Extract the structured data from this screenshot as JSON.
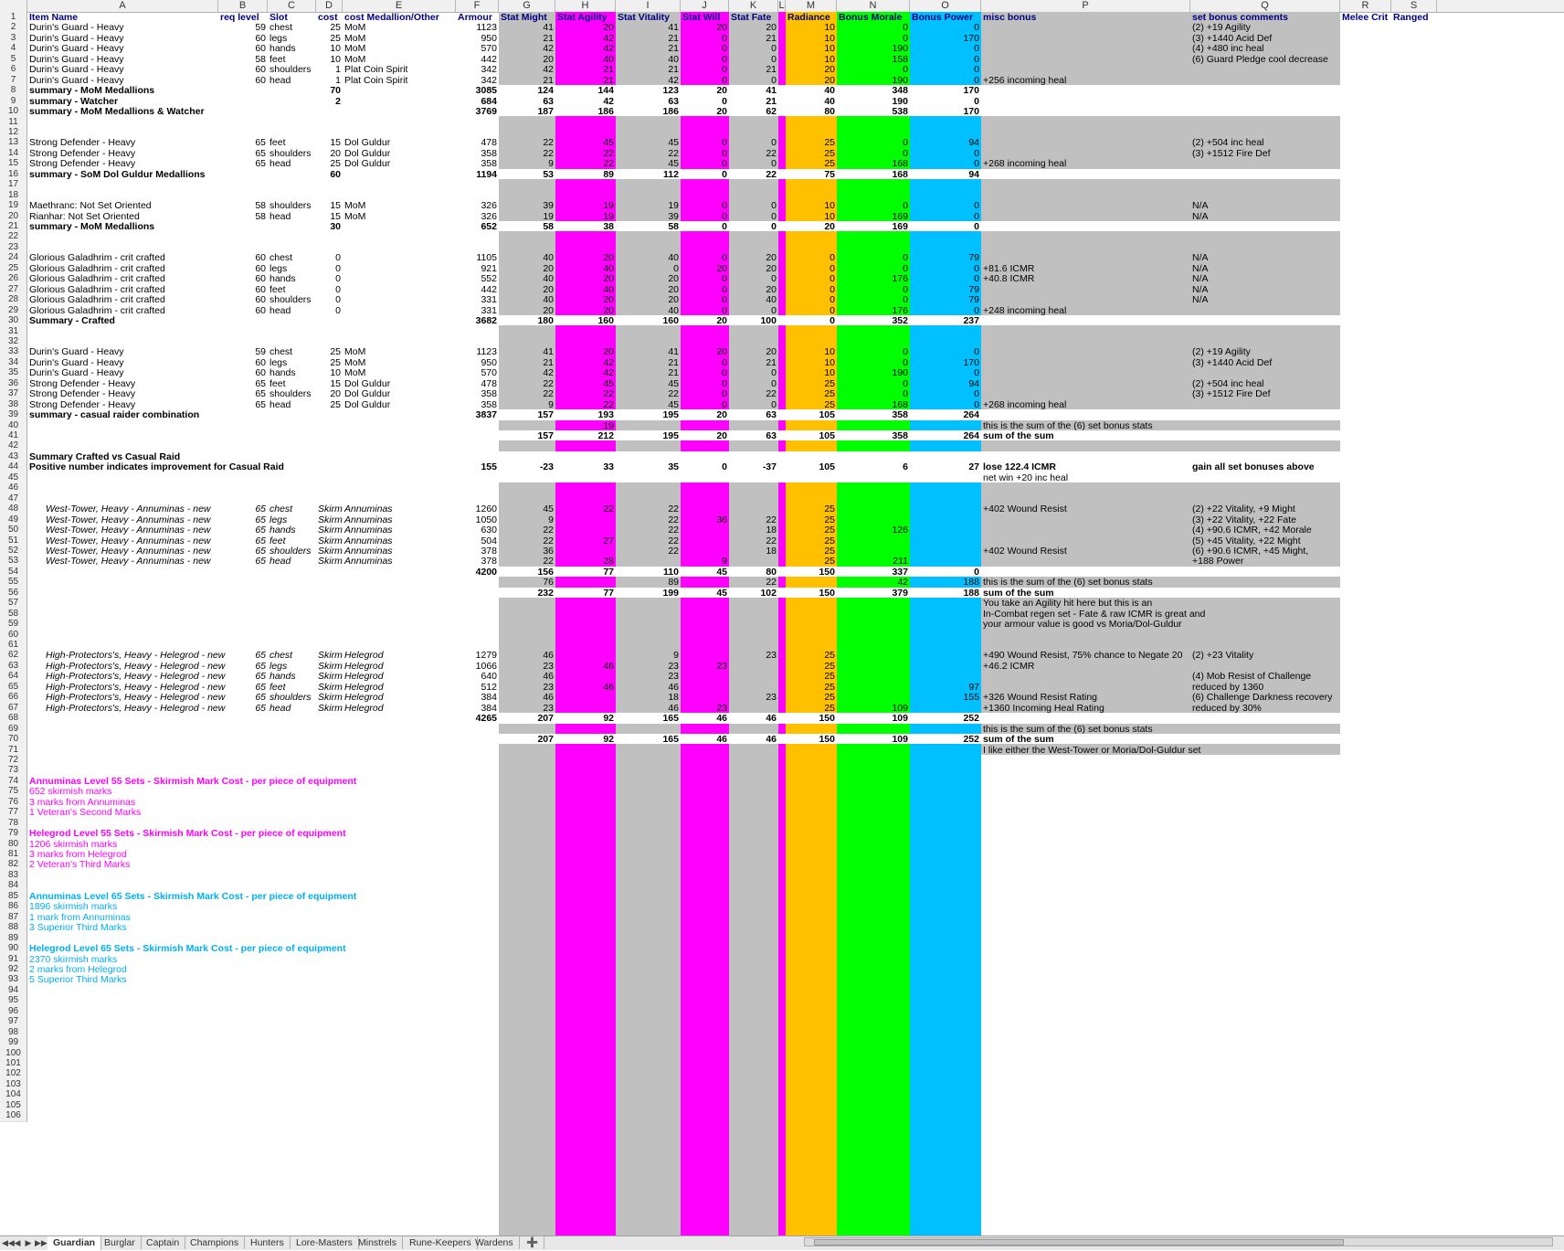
{
  "colors": {
    "gray": "#c0c0c0",
    "magenta": "#ff00ff",
    "orange": "#ffc000",
    "green": "#00ff00",
    "cyan": "#00c0ff",
    "header_text": "#000080",
    "pink_text": "#ff00ff",
    "blue_text": "#00b0f0"
  },
  "columns": [
    "A",
    "B",
    "C",
    "D",
    "E",
    "F",
    "G",
    "H",
    "I",
    "J",
    "K",
    "L",
    "M",
    "N",
    "O",
    "P",
    "Q",
    "R",
    "S"
  ],
  "header": {
    "A": "Item Name",
    "B": "req level",
    "C": "Slot",
    "D": "cost",
    "E": "cost Medallion/Other",
    "F": "Armour",
    "G": "Stat Might",
    "H": "Stat Agility",
    "I": "Stat Vitality",
    "J": "Stat Will",
    "K": "Stat Fate",
    "L": "",
    "M": "Radiance",
    "N": "Bonus Morale",
    "O": "Bonus Power",
    "P": "misc bonus",
    "Q": "set bonus comments",
    "R": "Melee Crit",
    "S": "Ranged"
  },
  "rows": [
    {
      "n": 2,
      "A": "Durin's Guard - Heavy",
      "B": "59",
      "C": "chest",
      "D": "25",
      "E": "MoM",
      "F": "1123",
      "G": "41",
      "H": "20",
      "I": "41",
      "J": "20",
      "K": "20",
      "M": "10",
      "N": "0",
      "O": "0",
      "Q": "(2) +19 Agility"
    },
    {
      "n": 3,
      "A": "Durin's Guard - Heavy",
      "B": "60",
      "C": "legs",
      "D": "25",
      "E": "MoM",
      "F": "950",
      "G": "21",
      "H": "42",
      "I": "21",
      "J": "0",
      "K": "21",
      "M": "10",
      "N": "0",
      "O": "170",
      "Q": "(3) +1440 Acid Def"
    },
    {
      "n": 4,
      "A": "Durin's Guard - Heavy",
      "B": "60",
      "C": "hands",
      "D": "10",
      "E": "MoM",
      "F": "570",
      "G": "42",
      "H": "42",
      "I": "21",
      "J": "0",
      "K": "0",
      "M": "10",
      "N": "190",
      "O": "0",
      "Q": "(4) +480 inc heal"
    },
    {
      "n": 5,
      "A": "Durin's Guard - Heavy",
      "B": "58",
      "C": "feet",
      "D": "10",
      "E": "MoM",
      "F": "442",
      "G": "20",
      "H": "40",
      "I": "40",
      "J": "0",
      "K": "0",
      "M": "10",
      "N": "158",
      "O": "0",
      "Q": "(6) Guard Pledge cool decrease"
    },
    {
      "n": 6,
      "A": "Durin's Guard - Heavy",
      "B": "60",
      "C": "shoulders",
      "D": "1",
      "E": "Plat Coin Spirit",
      "F": "342",
      "G": "42",
      "H": "21",
      "I": "21",
      "J": "0",
      "K": "21",
      "M": "20",
      "N": "0",
      "O": "0"
    },
    {
      "n": 7,
      "A": "Durin's Guard - Heavy",
      "B": "60",
      "C": "head",
      "D": "1",
      "E": "Plat Coin Spirit",
      "F": "342",
      "G": "21",
      "H": "21",
      "I": "42",
      "J": "0",
      "K": "0",
      "M": "20",
      "N": "190",
      "O": "0",
      "P": "+256 incoming heal"
    },
    {
      "n": 8,
      "A": "summary - MoM Medallions",
      "D": "70",
      "F": "3085",
      "G": "124",
      "H": "144",
      "I": "123",
      "J": "20",
      "K": "41",
      "M": "40",
      "N": "348",
      "O": "170",
      "bold": true,
      "white": true
    },
    {
      "n": 9,
      "A": "summary - Watcher",
      "D": "2",
      "F": "684",
      "G": "63",
      "H": "42",
      "I": "63",
      "J": "0",
      "K": "21",
      "M": "40",
      "N": "190",
      "O": "0",
      "bold": true,
      "white": true
    },
    {
      "n": 10,
      "A": "summary - MoM Medallions & Watcher",
      "F": "3769",
      "G": "187",
      "H": "186",
      "I": "186",
      "J": "20",
      "K": "62",
      "M": "80",
      "N": "538",
      "O": "170",
      "bold": true,
      "white": true
    },
    {
      "n": 11
    },
    {
      "n": 12
    },
    {
      "n": 13,
      "A": "Strong Defender - Heavy",
      "B": "65",
      "C": "feet",
      "D": "15",
      "E": "Dol Guldur",
      "F": "478",
      "G": "22",
      "H": "45",
      "I": "45",
      "J": "0",
      "K": "0",
      "M": "25",
      "N": "0",
      "O": "94",
      "Q": "(2) +504 inc heal"
    },
    {
      "n": 14,
      "A": "Strong Defender - Heavy",
      "B": "65",
      "C": "shoulders",
      "D": "20",
      "E": "Dol Guldur",
      "F": "358",
      "G": "22",
      "H": "22",
      "I": "22",
      "J": "0",
      "K": "22",
      "M": "25",
      "N": "0",
      "O": "0",
      "Q": "(3) +1512 Fire Def"
    },
    {
      "n": 15,
      "A": "Strong Defender - Heavy",
      "B": "65",
      "C": "head",
      "D": "25",
      "E": "Dol Guldur",
      "F": "358",
      "G": "9",
      "H": "22",
      "I": "45",
      "J": "0",
      "K": "0",
      "M": "25",
      "N": "168",
      "O": "0",
      "P": "+268 incoming heal"
    },
    {
      "n": 16,
      "A": "summary - SoM Dol Guldur Medallions",
      "D": "60",
      "F": "1194",
      "G": "53",
      "H": "89",
      "I": "112",
      "J": "0",
      "K": "22",
      "M": "75",
      "N": "168",
      "O": "94",
      "bold": true,
      "white": true
    },
    {
      "n": 17
    },
    {
      "n": 18
    },
    {
      "n": 19,
      "A": "Maethranc: Not Set Oriented",
      "B": "58",
      "C": "shoulders",
      "D": "15",
      "E": "MoM",
      "F": "326",
      "G": "39",
      "H": "19",
      "I": "19",
      "J": "0",
      "K": "0",
      "M": "10",
      "N": "0",
      "O": "0",
      "Q": "N/A"
    },
    {
      "n": 20,
      "A": "Rianhar: Not Set Oriented",
      "B": "58",
      "C": "head",
      "D": "15",
      "E": "MoM",
      "F": "326",
      "G": "19",
      "H": "19",
      "I": "39",
      "J": "0",
      "K": "0",
      "M": "10",
      "N": "169",
      "O": "0",
      "Q": "N/A"
    },
    {
      "n": 21,
      "A": "summary - MoM Medallions",
      "D": "30",
      "F": "652",
      "G": "58",
      "H": "38",
      "I": "58",
      "J": "0",
      "K": "0",
      "M": "20",
      "N": "169",
      "O": "0",
      "bold": true,
      "white": true
    },
    {
      "n": 22
    },
    {
      "n": 23
    },
    {
      "n": 24,
      "A": "Glorious Galadhrim - crit crafted",
      "B": "60",
      "C": "chest",
      "D": "0",
      "F": "1105",
      "G": "40",
      "H": "20",
      "I": "40",
      "J": "0",
      "K": "20",
      "M": "0",
      "N": "0",
      "O": "79",
      "Q": "N/A"
    },
    {
      "n": 25,
      "A": "Glorious Galadhrim - crit crafted",
      "B": "60",
      "C": "legs",
      "D": "0",
      "F": "921",
      "G": "20",
      "H": "40",
      "I": "0",
      "J": "20",
      "K": "20",
      "M": "0",
      "N": "0",
      "O": "0",
      "P": "+81.6 ICMR",
      "Q": "N/A"
    },
    {
      "n": 26,
      "A": "Glorious Galadhrim - crit crafted",
      "B": "60",
      "C": "hands",
      "D": "0",
      "F": "552",
      "G": "40",
      "H": "20",
      "I": "20",
      "J": "0",
      "K": "0",
      "M": "0",
      "N": "176",
      "O": "0",
      "P": "+40.8 ICMR",
      "Q": "N/A"
    },
    {
      "n": 27,
      "A": "Glorious Galadhrim - crit crafted",
      "B": "60",
      "C": "feet",
      "D": "0",
      "F": "442",
      "G": "20",
      "H": "40",
      "I": "20",
      "J": "0",
      "K": "20",
      "M": "0",
      "N": "0",
      "O": "79",
      "Q": "N/A"
    },
    {
      "n": 28,
      "A": "Glorious Galadhrim - crit crafted",
      "B": "60",
      "C": "shoulders",
      "D": "0",
      "F": "331",
      "G": "40",
      "H": "20",
      "I": "20",
      "J": "0",
      "K": "40",
      "M": "0",
      "N": "0",
      "O": "79",
      "Q": "N/A"
    },
    {
      "n": 29,
      "A": "Glorious Galadhrim - crit crafted",
      "B": "60",
      "C": "head",
      "D": "0",
      "F": "331",
      "G": "20",
      "H": "20",
      "I": "40",
      "J": "0",
      "K": "0",
      "M": "0",
      "N": "176",
      "O": "0",
      "P": "+248 incoming heal"
    },
    {
      "n": 30,
      "A": "Summary - Crafted",
      "F": "3682",
      "G": "180",
      "H": "160",
      "I": "160",
      "J": "20",
      "K": "100",
      "M": "0",
      "N": "352",
      "O": "237",
      "bold": true,
      "white": true
    },
    {
      "n": 31
    },
    {
      "n": 32
    },
    {
      "n": 33,
      "A": "Durin's Guard - Heavy",
      "B": "59",
      "C": "chest",
      "D": "25",
      "E": "MoM",
      "F": "1123",
      "G": "41",
      "H": "20",
      "I": "41",
      "J": "20",
      "K": "20",
      "M": "10",
      "N": "0",
      "O": "0",
      "Q": "(2) +19 Agility"
    },
    {
      "n": 34,
      "A": "Durin's Guard - Heavy",
      "B": "60",
      "C": "legs",
      "D": "25",
      "E": "MoM",
      "F": "950",
      "G": "21",
      "H": "42",
      "I": "21",
      "J": "0",
      "K": "21",
      "M": "10",
      "N": "0",
      "O": "170",
      "Q": "(3) +1440 Acid Def"
    },
    {
      "n": 35,
      "A": "Durin's Guard - Heavy",
      "B": "60",
      "C": "hands",
      "D": "10",
      "E": "MoM",
      "F": "570",
      "G": "42",
      "H": "42",
      "I": "21",
      "J": "0",
      "K": "0",
      "M": "10",
      "N": "190",
      "O": "0"
    },
    {
      "n": 36,
      "A": "Strong Defender - Heavy",
      "B": "65",
      "C": "feet",
      "D": "15",
      "E": "Dol Guldur",
      "F": "478",
      "G": "22",
      "H": "45",
      "I": "45",
      "J": "0",
      "K": "0",
      "M": "25",
      "N": "0",
      "O": "94",
      "Q": "(2) +504 inc heal"
    },
    {
      "n": 37,
      "A": "Strong Defender - Heavy",
      "B": "65",
      "C": "shoulders",
      "D": "20",
      "E": "Dol Guldur",
      "F": "358",
      "G": "22",
      "H": "22",
      "I": "22",
      "J": "0",
      "K": "22",
      "M": "25",
      "N": "0",
      "O": "0",
      "Q": "(3) +1512 Fire Def"
    },
    {
      "n": 38,
      "A": "Strong Defender - Heavy",
      "B": "65",
      "C": "head",
      "D": "25",
      "E": "Dol Guldur",
      "F": "358",
      "G": "9",
      "H": "22",
      "I": "45",
      "J": "0",
      "K": "0",
      "M": "25",
      "N": "168",
      "O": "0",
      "P": "+268 incoming heal"
    },
    {
      "n": 39,
      "A": "summary - casual raider combination",
      "F": "3837",
      "G": "157",
      "H": "193",
      "I": "195",
      "J": "20",
      "K": "63",
      "M": "105",
      "N": "358",
      "O": "264",
      "bold": true,
      "white": true
    },
    {
      "n": 40,
      "H": "19",
      "P": "this is the sum of the (6) set bonus stats"
    },
    {
      "n": 41,
      "G": "157",
      "H": "212",
      "I": "195",
      "J": "20",
      "K": "63",
      "M": "105",
      "N": "358",
      "O": "264",
      "P": "sum of the sum",
      "bold": true,
      "white": true
    },
    {
      "n": 42
    },
    {
      "n": 43,
      "A": "Summary Crafted vs Casual Raid",
      "bold": true,
      "white": true
    },
    {
      "n": 44,
      "A": "Positive number indicates improvement for Casual Raid",
      "F": "155",
      "G": "-23",
      "H": "33",
      "I": "35",
      "J": "0",
      "K": "-37",
      "M": "105",
      "N": "6",
      "O": "27",
      "P": "lose 122.4 ICMR",
      "Q": "gain all set bonuses above",
      "bold": true,
      "white": true
    },
    {
      "n": 45,
      "P": "net win +20 inc heal",
      "white": true
    },
    {
      "n": 46
    },
    {
      "n": 47
    },
    {
      "n": 48,
      "A": "West-Tower, Heavy - Annuminas - new",
      "B": "65",
      "C": "chest",
      "D": "Skirm",
      "E": "Annuminas",
      "F": "1260",
      "G": "45",
      "H": "22",
      "I": "22",
      "M": "25",
      "P": "+402 Wound Resist",
      "Q": "(2) +22 Vitality, +9 Might",
      "italic": true
    },
    {
      "n": 49,
      "A": "West-Tower, Heavy - Annuminas - new",
      "B": "65",
      "C": "legs",
      "D": "Skirm",
      "E": "Annuminas",
      "F": "1050",
      "G": "9",
      "I": "22",
      "J": "36",
      "K": "22",
      "M": "25",
      "Q": "(3) +22 Vitality, +22 Fate",
      "italic": true
    },
    {
      "n": 50,
      "A": "West-Tower, Heavy - Annuminas - new",
      "B": "65",
      "C": "hands",
      "D": "Skirm",
      "E": "Annuminas",
      "F": "630",
      "G": "22",
      "I": "22",
      "K": "18",
      "M": "25",
      "N": "126",
      "Q": "(4) +90.6 ICMR, +42 Morale",
      "italic": true
    },
    {
      "n": 51,
      "A": "West-Tower, Heavy - Annuminas - new",
      "B": "65",
      "C": "feet",
      "D": "Skirm",
      "E": "Annuminas",
      "F": "504",
      "G": "22",
      "H": "27",
      "I": "22",
      "K": "22",
      "M": "25",
      "Q": "(5) +45 Vitality, +22 Might",
      "italic": true
    },
    {
      "n": 52,
      "A": "West-Tower, Heavy - Annuminas - new",
      "B": "65",
      "C": "shoulders",
      "D": "Skirm",
      "E": "Annuminas",
      "F": "378",
      "G": "36",
      "I": "22",
      "K": "18",
      "M": "25",
      "P": "+402 Wound Resist",
      "Q": "(6) +90.6 ICMR, +45 Might,",
      "italic": true
    },
    {
      "n": 53,
      "A": "West-Tower, Heavy - Annuminas - new",
      "B": "65",
      "C": "head",
      "D": "Skirm",
      "E": "Annuminas",
      "F": "378",
      "G": "22",
      "H": "28",
      "J": "9",
      "M": "25",
      "N": "211",
      "Q": "+188 Power",
      "italic": true
    },
    {
      "n": 54,
      "F": "4200",
      "G": "156",
      "H": "77",
      "I": "110",
      "J": "45",
      "K": "80",
      "M": "150",
      "N": "337",
      "O": "0",
      "bold": true,
      "white": true
    },
    {
      "n": 55,
      "G": "76",
      "I": "89",
      "K": "22",
      "N": "42",
      "O": "188",
      "P": "this is the sum of the (6) set bonus stats"
    },
    {
      "n": 56,
      "G": "232",
      "H": "77",
      "I": "199",
      "J": "45",
      "K": "102",
      "M": "150",
      "N": "379",
      "O": "188",
      "P": "sum of the sum",
      "bold": true,
      "white": true
    },
    {
      "n": 57,
      "P": "You take an Agility hit here but this is an"
    },
    {
      "n": 58,
      "P": "In-Combat regen set - Fate & raw ICMR is great and"
    },
    {
      "n": 59,
      "P": "your armour value is good vs Moria/Dol-Guldur"
    },
    {
      "n": 60
    },
    {
      "n": 61
    },
    {
      "n": 62,
      "A": "High-Protectors's, Heavy - Helegrod - new",
      "B": "65",
      "C": "chest",
      "D": "Skirm",
      "E": "Helegrod",
      "F": "1279",
      "G": "46",
      "I": "9",
      "K": "23",
      "M": "25",
      "P": "+490 Wound Resist, 75% chance to Negate 20",
      "Q": "(2) +23 Vitality",
      "italic": true
    },
    {
      "n": 63,
      "A": "High-Protectors's, Heavy - Helegrod - new",
      "B": "65",
      "C": "legs",
      "D": "Skirm",
      "E": "Helegrod",
      "F": "1066",
      "G": "23",
      "H": "46",
      "I": "23",
      "J": "23",
      "M": "25",
      "P": "+46.2 ICMR",
      "italic": true
    },
    {
      "n": 64,
      "A": "High-Protectors's, Heavy - Helegrod - new",
      "B": "65",
      "C": "hands",
      "D": "Skirm",
      "E": "Helegrod",
      "F": "640",
      "G": "46",
      "I": "23",
      "M": "25",
      "Q": "(4) Mob Resist of Challenge",
      "italic": true
    },
    {
      "n": 65,
      "A": "High-Protectors's, Heavy - Helegrod - new",
      "B": "65",
      "C": "feet",
      "D": "Skirm",
      "E": "Helegrod",
      "F": "512",
      "G": "23",
      "H": "46",
      "I": "46",
      "M": "25",
      "O": "97",
      "Q": "reduced by 1360",
      "italic": true
    },
    {
      "n": 66,
      "A": "High-Protectors's, Heavy - Helegrod - new",
      "B": "65",
      "C": "shoulders",
      "D": "Skirm",
      "E": "Helegrod",
      "F": "384",
      "G": "46",
      "I": "18",
      "K": "23",
      "M": "25",
      "O": "155",
      "P": "+326 Wound Resist Rating",
      "Q": "(6) Challenge Darkness recovery",
      "italic": true
    },
    {
      "n": 67,
      "A": "High-Protectors's, Heavy - Helegrod - new",
      "B": "65",
      "C": "head",
      "D": "Skirm",
      "E": "Helegrod",
      "F": "384",
      "G": "23",
      "I": "46",
      "J": "23",
      "M": "25",
      "N": "109",
      "P": "+1360 Incoming Heal Rating",
      "Q": "reduced by 30%",
      "italic": true
    },
    {
      "n": 68,
      "F": "4265",
      "G": "207",
      "H": "92",
      "I": "165",
      "J": "46",
      "K": "46",
      "M": "150",
      "N": "109",
      "O": "252",
      "bold": true,
      "white": true
    },
    {
      "n": 69,
      "P": "this is the sum of the (6) set bonus stats"
    },
    {
      "n": 70,
      "G": "207",
      "H": "92",
      "I": "165",
      "J": "46",
      "K": "46",
      "M": "150",
      "N": "109",
      "O": "252",
      "P": "sum of the sum",
      "bold": true,
      "white": true
    },
    {
      "n": 71,
      "P": "I like either the West-Tower or Moria/Dol-Guldur set"
    },
    {
      "n": 72
    },
    {
      "n": 73
    },
    {
      "n": 74,
      "A": "Annuminas Level 55 Sets - Skirmish Mark Cost - per piece of equipment",
      "pink": true,
      "bold": true
    },
    {
      "n": 75,
      "A": "   652 skirmish marks",
      "pink": true
    },
    {
      "n": 76,
      "A": "   3 marks from Annuminas",
      "pink": true
    },
    {
      "n": 77,
      "A": "   1 Veteran's Second Marks",
      "pink": true
    },
    {
      "n": 78
    },
    {
      "n": 79,
      "A": "Helegrod Level 55 Sets - Skirmish Mark Cost - per piece of equipment",
      "pink": true,
      "bold": true
    },
    {
      "n": 80,
      "A": "   1206 skirmish marks",
      "pink": true
    },
    {
      "n": 81,
      "A": "   3 marks from Helegrod",
      "pink": true
    },
    {
      "n": 82,
      "A": "   2 Veteran's Third Marks",
      "pink": true
    },
    {
      "n": 83
    },
    {
      "n": 84
    },
    {
      "n": 85,
      "A": "Annuminas Level 65 Sets - Skirmish Mark Cost - per piece of equipment",
      "blue": true,
      "bold": true
    },
    {
      "n": 86,
      "A": "   1896 skirmish marks",
      "blue": true
    },
    {
      "n": 87,
      "A": "   1 mark from Annuminas",
      "blue": true
    },
    {
      "n": 88,
      "A": "   3 Superior Third Marks",
      "blue": true
    },
    {
      "n": 89
    },
    {
      "n": 90,
      "A": "Helegrod Level 65 Sets - Skirmish Mark Cost - per piece of equipment",
      "blue": true,
      "bold": true
    },
    {
      "n": 91,
      "A": "   2370 skirmish marks",
      "blue": true
    },
    {
      "n": 92,
      "A": "   2 marks from Helegrod",
      "blue": true
    },
    {
      "n": 93,
      "A": "   5 Superior Third Marks",
      "blue": true
    },
    {
      "n": 94
    },
    {
      "n": 95
    },
    {
      "n": 96
    },
    {
      "n": 97
    },
    {
      "n": 98
    },
    {
      "n": 99
    },
    {
      "n": 100
    },
    {
      "n": 101
    },
    {
      "n": 102
    },
    {
      "n": 103
    },
    {
      "n": 104
    },
    {
      "n": 105
    },
    {
      "n": 106
    }
  ],
  "tabs": [
    "Guardian",
    "Burglar",
    "Captain",
    "Champions",
    "Hunters",
    "Lore-Masters",
    "Minstrels",
    "Rune-Keepers",
    "Wardens"
  ],
  "active_tab": "Guardian",
  "nav_icons": [
    "first-sheet-icon",
    "prev-sheet-icon",
    "next-sheet-icon",
    "last-sheet-icon"
  ]
}
